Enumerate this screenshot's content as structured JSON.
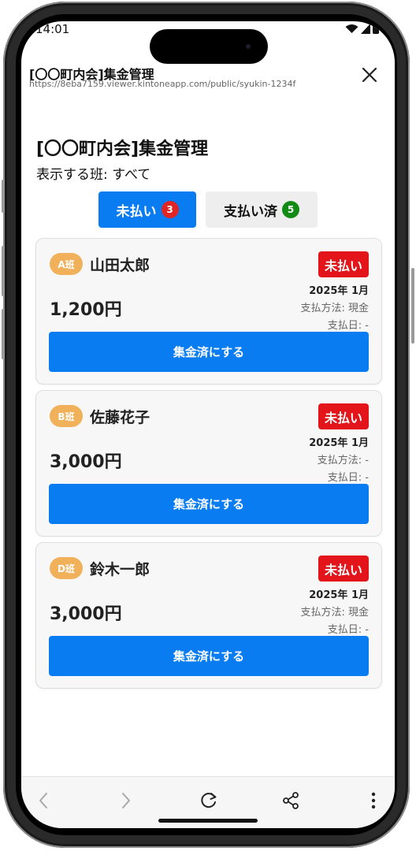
{
  "status_bar": {
    "time": "14:01"
  },
  "header": {
    "title": "[〇〇町内会]集金管理",
    "url": "https://8eba7159.viewer.kintoneapp.com/public/syukin-1234f"
  },
  "page": {
    "title": "[〇〇町内会]集金管理",
    "group_filter": "表示する班: すべて"
  },
  "tabs": [
    {
      "label": "未払い",
      "count": "3",
      "active": true
    },
    {
      "label": "支払い済",
      "count": "5",
      "active": false
    }
  ],
  "records": [
    {
      "group": "A班",
      "name": "山田太郎",
      "status": "未払い",
      "amount": "1,200円",
      "month": "2025年 1月",
      "method": "支払方法: 現金",
      "paid_date": "支払日: -",
      "button": "集金済にする"
    },
    {
      "group": "B班",
      "name": "佐藤花子",
      "status": "未払い",
      "amount": "3,000円",
      "month": "2025年 1月",
      "method": "支払方法: -",
      "paid_date": "支払日: -",
      "button": "集金済にする"
    },
    {
      "group": "D班",
      "name": "鈴木一郎",
      "status": "未払い",
      "amount": "3,000円",
      "month": "2025年 1月",
      "method": "支払方法: 現金",
      "paid_date": "支払日: -",
      "button": "集金済にする"
    }
  ],
  "toolbar": {
    "icons": [
      "back-icon",
      "forward-icon",
      "reload-icon",
      "share-icon",
      "more-icon"
    ]
  },
  "colors": {
    "primary": "#0a7cf2",
    "unpaid": "#e3141a",
    "group_badge": "#f0b15a",
    "count_red": "#e12525",
    "count_green": "#128a16"
  }
}
